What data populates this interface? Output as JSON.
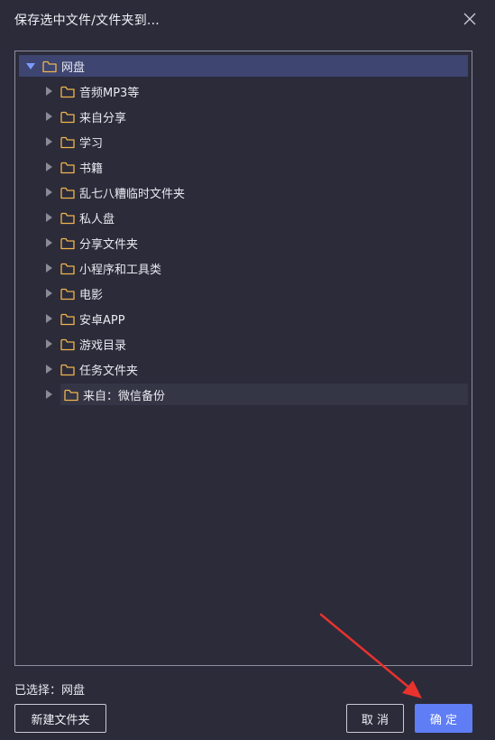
{
  "dialog": {
    "title": "保存选中文件/文件夹到...",
    "close_icon": "close-icon"
  },
  "tree": {
    "root": {
      "label": "网盘",
      "expanded": true,
      "selected": true
    },
    "items": [
      {
        "label": "音频MP3等"
      },
      {
        "label": "来自分享"
      },
      {
        "label": "学习"
      },
      {
        "label": "书籍"
      },
      {
        "label": "乱七八糟临时文件夹"
      },
      {
        "label": "私人盘"
      },
      {
        "label": "分享文件夹"
      },
      {
        "label": "小程序和工具类"
      },
      {
        "label": "电影"
      },
      {
        "label": "安卓APP"
      },
      {
        "label": "游戏目录"
      },
      {
        "label": "任务文件夹"
      },
      {
        "label": "来自：微信备份",
        "hovered": true
      }
    ]
  },
  "footer": {
    "selected_prefix": "已选择：",
    "selected_value": "网盘",
    "new_folder_label": "新建文件夹",
    "cancel_label": "取 消",
    "confirm_label": "确 定"
  },
  "colors": {
    "dialog_bg": "#2b2b3a",
    "root_row_bg": "#3d4570",
    "folder_icon": "#f0b44c",
    "primary_button": "#5f7df5",
    "annotation_arrow": "#e8322e"
  }
}
